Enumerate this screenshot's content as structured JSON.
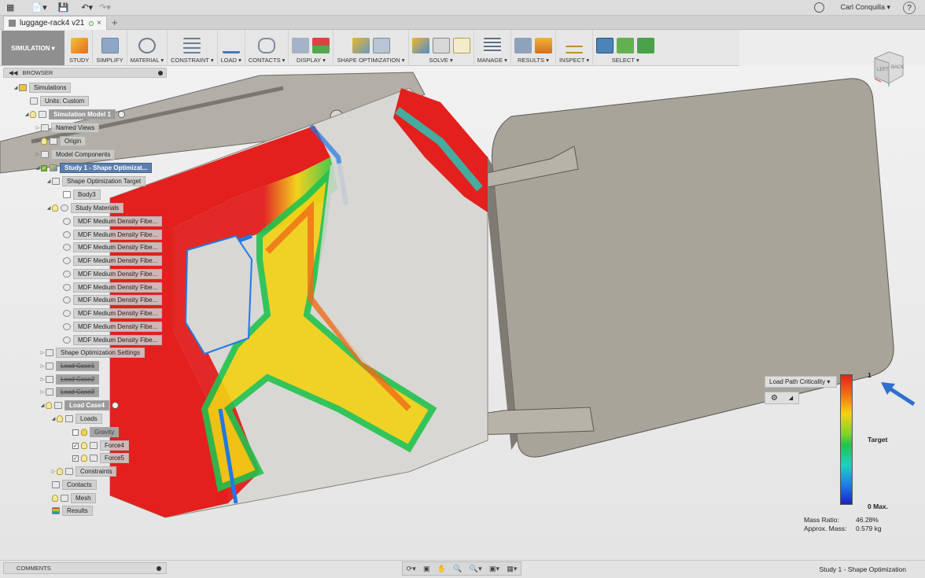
{
  "topbar": {
    "user": "Carl Conquilla ▾",
    "help": "?"
  },
  "tabs": [
    {
      "label": "luggage-rack4 v21",
      "close": "×"
    }
  ],
  "tab_plus": "+",
  "ribbon": {
    "mode": "SIMULATION ▾",
    "groups": [
      {
        "label": "STUDY"
      },
      {
        "label": "SIMPLIFY"
      },
      {
        "label": "MATERIAL ▾"
      },
      {
        "label": "CONSTRAINT ▾"
      },
      {
        "label": "LOAD ▾"
      },
      {
        "label": "CONTACTS ▾"
      },
      {
        "label": "DISPLAY ▾"
      },
      {
        "label": "SHAPE OPTIMIZATION ▾"
      },
      {
        "label": "SOLVE ▾"
      },
      {
        "label": "MANAGE ▾"
      },
      {
        "label": "RESULTS ▾"
      },
      {
        "label": "INSPECT ▾"
      },
      {
        "label": "SELECT ▾"
      }
    ]
  },
  "browser": {
    "title": "BROWSER",
    "nodes": [
      {
        "label": "Simulations"
      },
      {
        "label": "Units: Custom"
      },
      {
        "label": "Simulation Model 1"
      },
      {
        "label": "Named Views"
      },
      {
        "label": "Origin"
      },
      {
        "label": "Model Components"
      },
      {
        "label": "Study 1 - Shape Optimizat..."
      },
      {
        "label": "Shape Optimization Target"
      },
      {
        "label": "Body3"
      },
      {
        "label": "Study Materials"
      },
      {
        "label": "MDF Medium Density Fibe..."
      },
      {
        "label": "MDF Medium Density Fibe..."
      },
      {
        "label": "MDF Medium Density Fibe..."
      },
      {
        "label": "MDF Medium Density Fibe..."
      },
      {
        "label": "MDF Medium Density Fibe..."
      },
      {
        "label": "MDF Medium Density Fibe..."
      },
      {
        "label": "MDF Medium Density Fibe..."
      },
      {
        "label": "MDF Medium Density Fibe..."
      },
      {
        "label": "MDF Medium Density Fibe..."
      },
      {
        "label": "MDF Medium Density Fibe..."
      },
      {
        "label": "Shape Optimization Settings"
      },
      {
        "label": "Load Case1"
      },
      {
        "label": "Load Case2"
      },
      {
        "label": "Load Case3"
      },
      {
        "label": "Load Case4"
      },
      {
        "label": "Loads"
      },
      {
        "label": "Gravity"
      },
      {
        "label": "Force4"
      },
      {
        "label": "Force5"
      },
      {
        "label": "Constraints"
      },
      {
        "label": "Contacts"
      },
      {
        "label": "Mesh"
      },
      {
        "label": "Results"
      }
    ]
  },
  "viewcube": {
    "left": "LEFT",
    "back": "BACK"
  },
  "legend": {
    "title": "Load Path Criticality ▾",
    "max": "1",
    "mid": "Target",
    "min": "0 Max."
  },
  "stats": {
    "mass_ratio_label": "Mass Ratio:",
    "mass_ratio_value": "46.28%",
    "mass_label": "Approx. Mass:",
    "mass_value": "0.579 kg"
  },
  "comments": {
    "title": "COMMENTS"
  },
  "status": {
    "study": "Study 1 - Shape Optimization"
  },
  "colors": {
    "critical": "#e3201d",
    "target": "#22c34f",
    "low": "#1b22c4",
    "part": "#a9a49a",
    "selection": "#5a7fb0"
  }
}
